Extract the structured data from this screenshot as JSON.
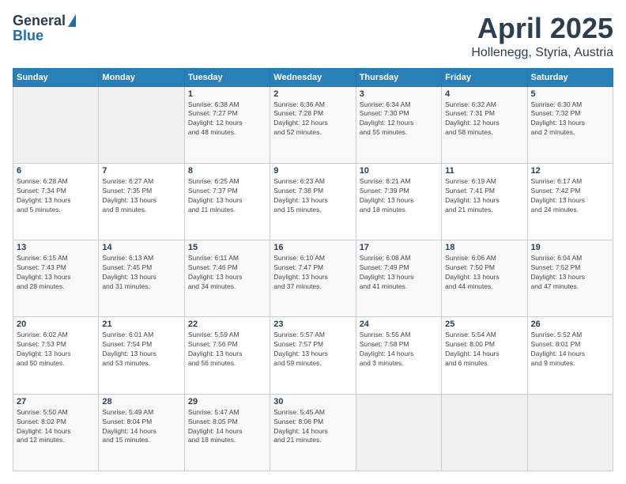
{
  "header": {
    "logo_general": "General",
    "logo_blue": "Blue",
    "title": "April 2025",
    "location": "Hollenegg, Styria, Austria"
  },
  "days_of_week": [
    "Sunday",
    "Monday",
    "Tuesday",
    "Wednesday",
    "Thursday",
    "Friday",
    "Saturday"
  ],
  "weeks": [
    [
      {
        "num": "",
        "info": ""
      },
      {
        "num": "",
        "info": ""
      },
      {
        "num": "1",
        "info": "Sunrise: 6:38 AM\nSunset: 7:27 PM\nDaylight: 12 hours\nand 48 minutes."
      },
      {
        "num": "2",
        "info": "Sunrise: 6:36 AM\nSunset: 7:28 PM\nDaylight: 12 hours\nand 52 minutes."
      },
      {
        "num": "3",
        "info": "Sunrise: 6:34 AM\nSunset: 7:30 PM\nDaylight: 12 hours\nand 55 minutes."
      },
      {
        "num": "4",
        "info": "Sunrise: 6:32 AM\nSunset: 7:31 PM\nDaylight: 12 hours\nand 58 minutes."
      },
      {
        "num": "5",
        "info": "Sunrise: 6:30 AM\nSunset: 7:32 PM\nDaylight: 13 hours\nand 2 minutes."
      }
    ],
    [
      {
        "num": "6",
        "info": "Sunrise: 6:28 AM\nSunset: 7:34 PM\nDaylight: 13 hours\nand 5 minutes."
      },
      {
        "num": "7",
        "info": "Sunrise: 6:27 AM\nSunset: 7:35 PM\nDaylight: 13 hours\nand 8 minutes."
      },
      {
        "num": "8",
        "info": "Sunrise: 6:25 AM\nSunset: 7:37 PM\nDaylight: 13 hours\nand 11 minutes."
      },
      {
        "num": "9",
        "info": "Sunrise: 6:23 AM\nSunset: 7:38 PM\nDaylight: 13 hours\nand 15 minutes."
      },
      {
        "num": "10",
        "info": "Sunrise: 6:21 AM\nSunset: 7:39 PM\nDaylight: 13 hours\nand 18 minutes."
      },
      {
        "num": "11",
        "info": "Sunrise: 6:19 AM\nSunset: 7:41 PM\nDaylight: 13 hours\nand 21 minutes."
      },
      {
        "num": "12",
        "info": "Sunrise: 6:17 AM\nSunset: 7:42 PM\nDaylight: 13 hours\nand 24 minutes."
      }
    ],
    [
      {
        "num": "13",
        "info": "Sunrise: 6:15 AM\nSunset: 7:43 PM\nDaylight: 13 hours\nand 28 minutes."
      },
      {
        "num": "14",
        "info": "Sunrise: 6:13 AM\nSunset: 7:45 PM\nDaylight: 13 hours\nand 31 minutes."
      },
      {
        "num": "15",
        "info": "Sunrise: 6:11 AM\nSunset: 7:46 PM\nDaylight: 13 hours\nand 34 minutes."
      },
      {
        "num": "16",
        "info": "Sunrise: 6:10 AM\nSunset: 7:47 PM\nDaylight: 13 hours\nand 37 minutes."
      },
      {
        "num": "17",
        "info": "Sunrise: 6:08 AM\nSunset: 7:49 PM\nDaylight: 13 hours\nand 41 minutes."
      },
      {
        "num": "18",
        "info": "Sunrise: 6:06 AM\nSunset: 7:50 PM\nDaylight: 13 hours\nand 44 minutes."
      },
      {
        "num": "19",
        "info": "Sunrise: 6:04 AM\nSunset: 7:52 PM\nDaylight: 13 hours\nand 47 minutes."
      }
    ],
    [
      {
        "num": "20",
        "info": "Sunrise: 6:02 AM\nSunset: 7:53 PM\nDaylight: 13 hours\nand 50 minutes."
      },
      {
        "num": "21",
        "info": "Sunrise: 6:01 AM\nSunset: 7:54 PM\nDaylight: 13 hours\nand 53 minutes."
      },
      {
        "num": "22",
        "info": "Sunrise: 5:59 AM\nSunset: 7:56 PM\nDaylight: 13 hours\nand 56 minutes."
      },
      {
        "num": "23",
        "info": "Sunrise: 5:57 AM\nSunset: 7:57 PM\nDaylight: 13 hours\nand 59 minutes."
      },
      {
        "num": "24",
        "info": "Sunrise: 5:55 AM\nSunset: 7:58 PM\nDaylight: 14 hours\nand 3 minutes."
      },
      {
        "num": "25",
        "info": "Sunrise: 5:54 AM\nSunset: 8:00 PM\nDaylight: 14 hours\nand 6 minutes."
      },
      {
        "num": "26",
        "info": "Sunrise: 5:52 AM\nSunset: 8:01 PM\nDaylight: 14 hours\nand 9 minutes."
      }
    ],
    [
      {
        "num": "27",
        "info": "Sunrise: 5:50 AM\nSunset: 8:02 PM\nDaylight: 14 hours\nand 12 minutes."
      },
      {
        "num": "28",
        "info": "Sunrise: 5:49 AM\nSunset: 8:04 PM\nDaylight: 14 hours\nand 15 minutes."
      },
      {
        "num": "29",
        "info": "Sunrise: 5:47 AM\nSunset: 8:05 PM\nDaylight: 14 hours\nand 18 minutes."
      },
      {
        "num": "30",
        "info": "Sunrise: 5:45 AM\nSunset: 8:06 PM\nDaylight: 14 hours\nand 21 minutes."
      },
      {
        "num": "",
        "info": ""
      },
      {
        "num": "",
        "info": ""
      },
      {
        "num": "",
        "info": ""
      }
    ]
  ]
}
